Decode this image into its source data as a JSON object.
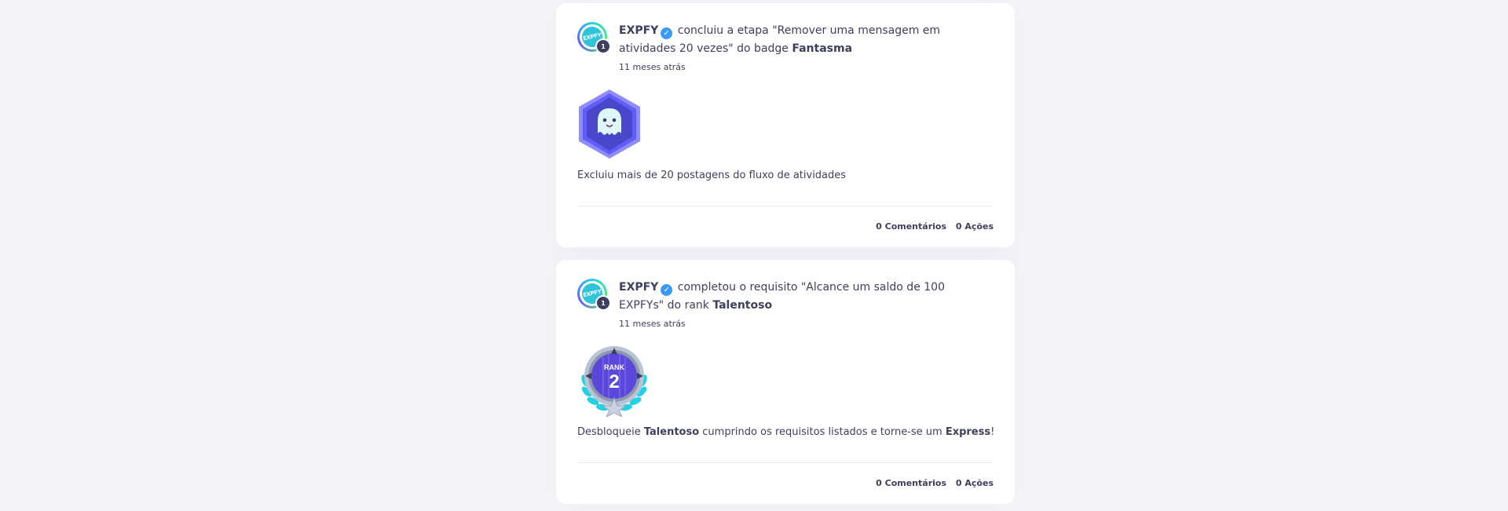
{
  "posts": [
    {
      "avatar_text": "EXPFY",
      "level": "1",
      "author": "EXPFY",
      "action_text": " concluiu a etapa \"Remover uma mensagem em atividades 20 vezes\" do badge ",
      "target": "Fantasma",
      "timestamp": "11 meses atrás",
      "desc_parts": [
        "Excluiu mais de 20 postagens do fluxo de atividades"
      ],
      "comments": "0 Comentários",
      "shares": "0 Ações"
    },
    {
      "avatar_text": "EXPFY",
      "level": "1",
      "author": "EXPFY",
      "action_text": " completou o requisito \"Alcance um saldo de 100 EXPFYs\" do rank ",
      "target": "Talentoso",
      "timestamp": "11 meses atrás",
      "rank_label": "RANK",
      "rank_number": "2",
      "desc_parts": [
        "Desbloqueie ",
        "Talentoso",
        " cumprindo os requisitos listados e torne-se um ",
        "Express",
        "!"
      ],
      "comments": "0 Comentários",
      "shares": "0 Ações"
    }
  ],
  "colors": {
    "text": "#3e3f5e",
    "verified": "#3b99f7",
    "badge_purple": "#615dfa",
    "rank_teal": "#23d2e2"
  },
  "icons": {
    "verified": "check-circle",
    "badge": "ghost-hexagon",
    "rank": "rank-medal-laurel"
  }
}
